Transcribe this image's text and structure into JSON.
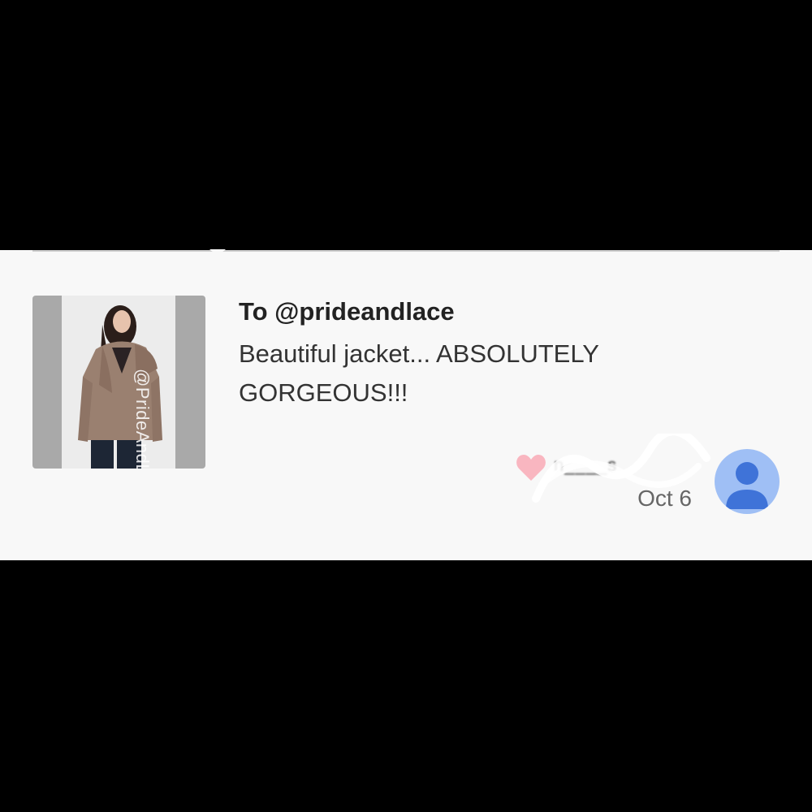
{
  "notification": {
    "title": "To @prideandlace",
    "message": "Beautiful jacket... ABSOLUTELY GORGEOUS!!!",
    "thumbnail_watermark": "@PrideAndLace",
    "username": "n____s",
    "date": "Oct 6"
  },
  "colors": {
    "heart": "#f9b6c0",
    "avatar_bg": "#9fbff5",
    "avatar_icon": "#3f73d8"
  },
  "icons": [
    "heart-icon",
    "avatar-person-icon"
  ]
}
